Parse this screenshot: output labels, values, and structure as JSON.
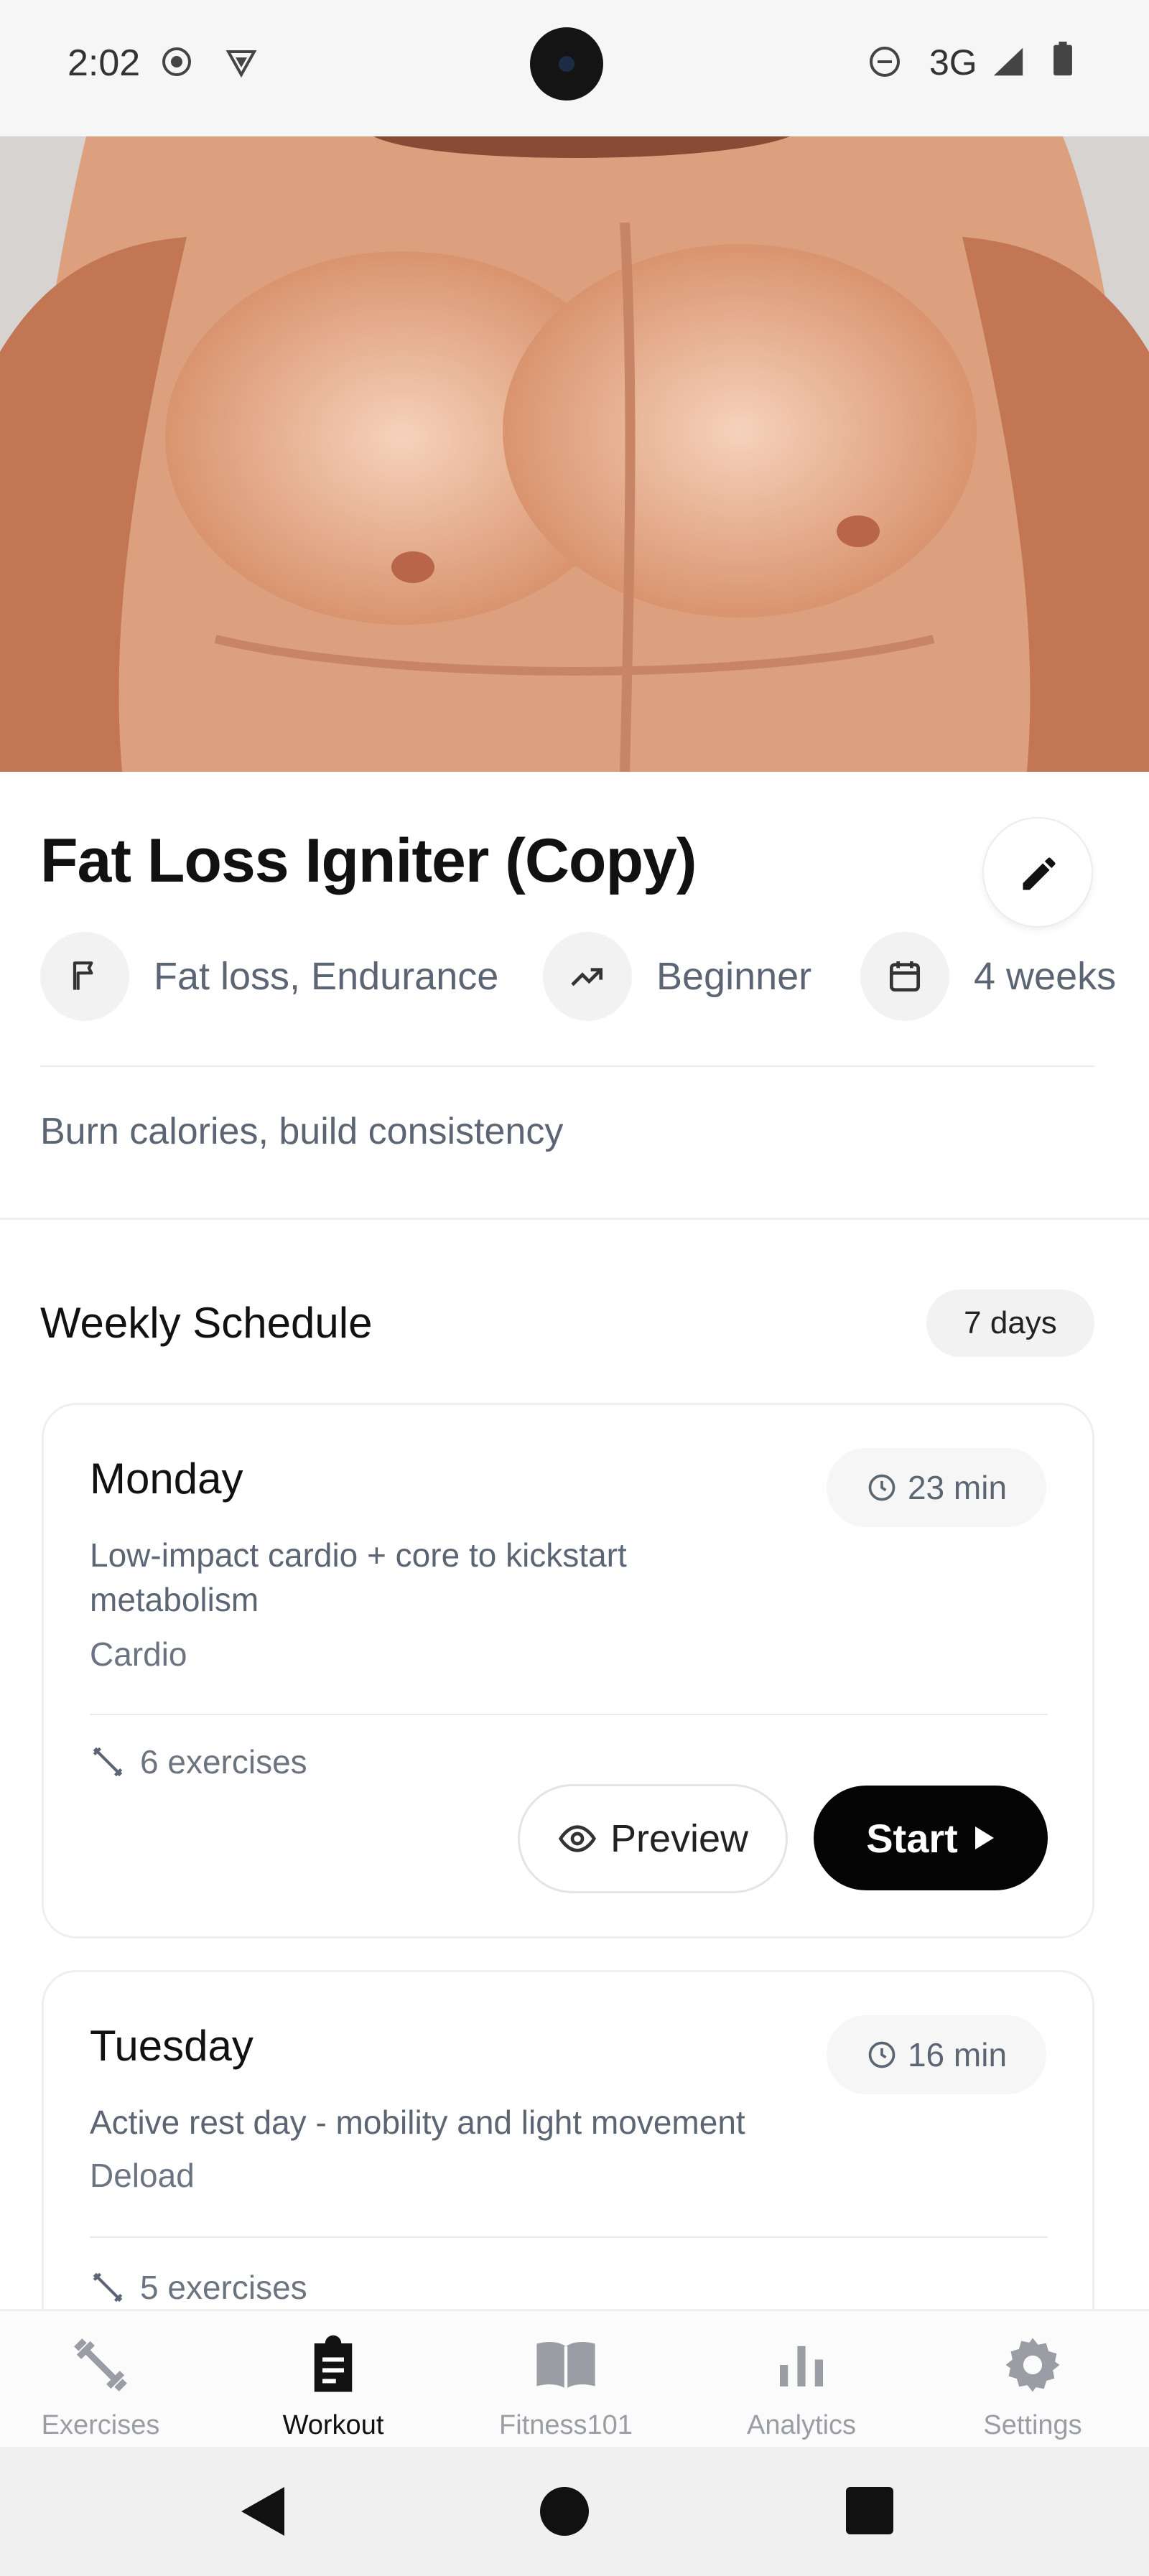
{
  "status_bar": {
    "time": "2:02",
    "network": "3G"
  },
  "program": {
    "title": "Fat Loss Igniter (Copy)",
    "goal": "Fat loss, Endurance",
    "level": "Beginner",
    "duration": "4 weeks",
    "description": "Burn calories, build consistency"
  },
  "schedule": {
    "title": "Weekly Schedule",
    "badge": "7 days",
    "days": [
      {
        "day": "Monday",
        "duration": "23 min",
        "summary": "Low-impact cardio + core to kickstart metabolism",
        "category": "Cardio",
        "exercises": "6 exercises",
        "preview_label": "Preview",
        "start_label": "Start"
      },
      {
        "day": "Tuesday",
        "duration": "16 min",
        "summary": "Active rest day - mobility and light movement",
        "category": "Deload",
        "exercises": "5 exercises"
      }
    ]
  },
  "bottom_nav": [
    {
      "label": "Exercises",
      "icon": "dumbbell-icon",
      "active": false
    },
    {
      "label": "Workout",
      "icon": "clipboard-icon",
      "active": true
    },
    {
      "label": "Fitness101",
      "icon": "book-icon",
      "active": false
    },
    {
      "label": "Analytics",
      "icon": "bar-chart-icon",
      "active": false
    },
    {
      "label": "Settings",
      "icon": "gear-icon",
      "active": false
    }
  ],
  "colors": {
    "accent": "#050505",
    "muted_text": "#5b6573",
    "chip_bg": "#f2f2f3"
  }
}
